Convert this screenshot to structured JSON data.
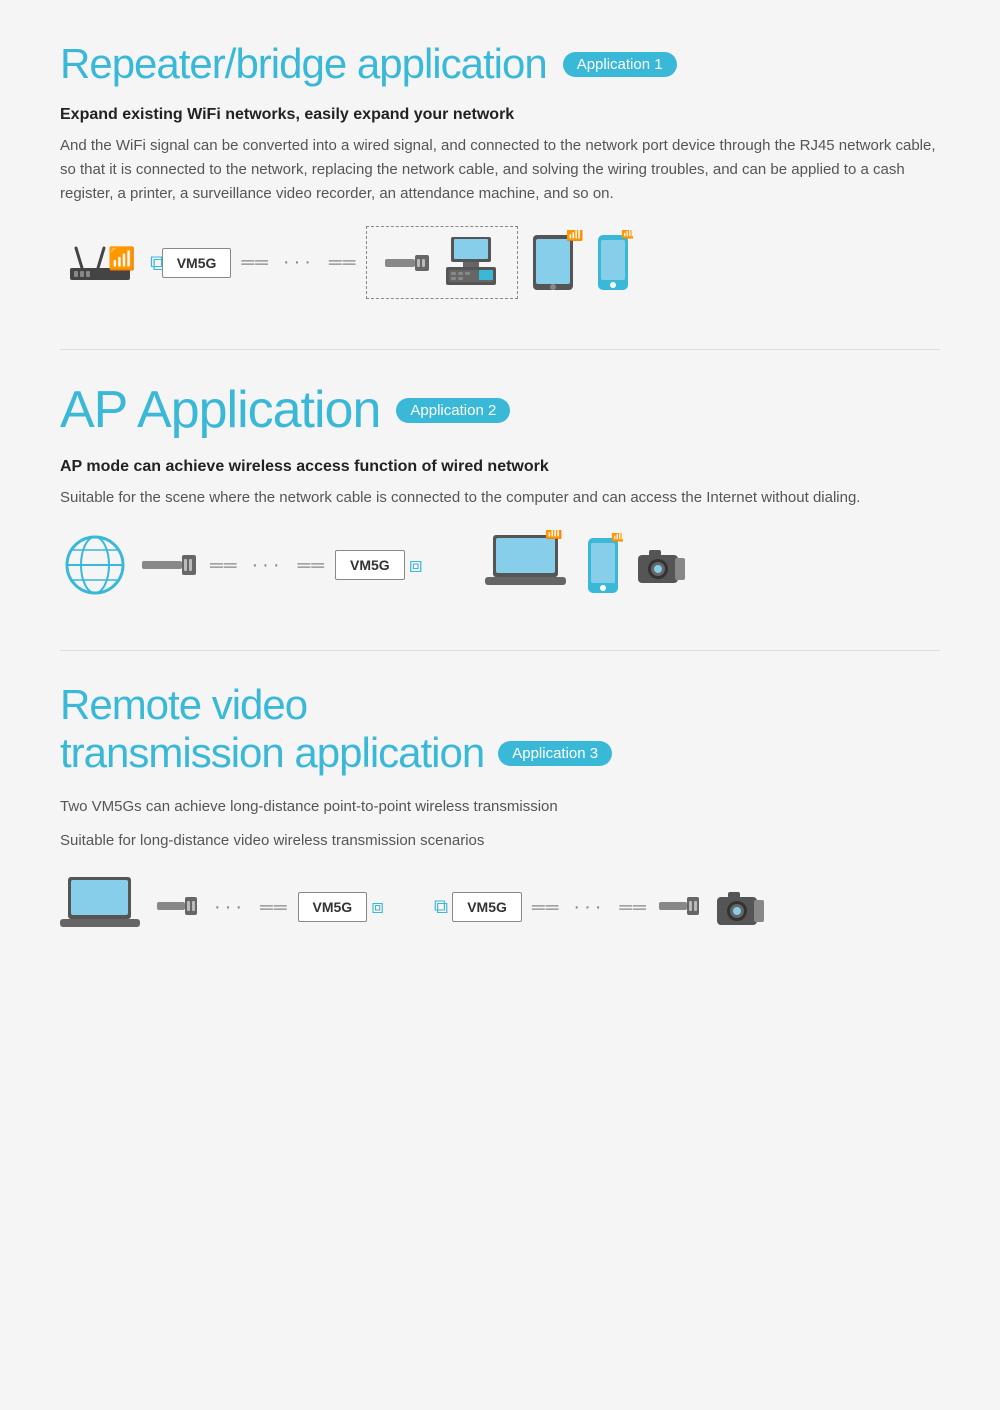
{
  "section1": {
    "title": "Repeater/bridge application",
    "badge": "Application 1",
    "subtitle": "Expand existing WiFi networks,  easily expand your network",
    "body": "And the WiFi signal can be converted into a wired signal, and connected to the network port device through the RJ45 network cable, so that it is connected to the network, replacing the network cable, and solving the wiring troubles, and can be applied to a cash register, a printer, a surveillance video recorder, an attendance machine, and so on.",
    "vm5g_label": "VM5G"
  },
  "section2": {
    "title": "AP Application",
    "badge": "Application 2",
    "subtitle": "AP mode can achieve wireless access function of wired network",
    "body": "Suitable for the scene where the network cable is connected to the computer and can access the Internet without dialing.",
    "vm5g_label": "VM5G"
  },
  "section3": {
    "title_line1": "Remote video",
    "title_line2": "transmission application",
    "badge": "Application 3",
    "body1": "Two VM5Gs can achieve long-distance point-to-point wireless transmission",
    "body2": "Suitable for long-distance video wireless transmission scenarios",
    "vm5g_label1": "VM5G",
    "vm5g_label2": "VM5G"
  }
}
